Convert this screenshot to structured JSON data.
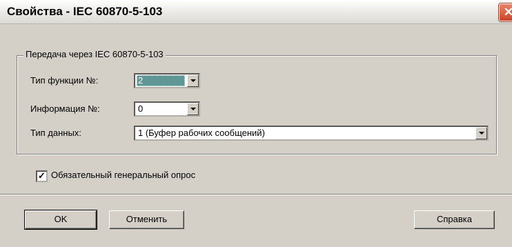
{
  "window": {
    "title": "Свойства - IEC 60870-5-103",
    "close_glyph": "✕"
  },
  "group": {
    "legend": "Передача через IEC 60870-5-103"
  },
  "fields": {
    "function_type": {
      "label": "Тип функции №:",
      "value": "2"
    },
    "info_number": {
      "label": "Информация №:",
      "value": "0"
    },
    "data_type": {
      "label": "Тип данных:",
      "value": "1 (Буфер рабочих сообщений)"
    }
  },
  "checkbox": {
    "label": "Обязательный генеральный опрос",
    "checked": true,
    "check_glyph": "✓"
  },
  "buttons": {
    "ok": "OK",
    "cancel": "Отменить",
    "help": "Справка"
  },
  "colors": {
    "face": "#d4d0c8",
    "selection": "#5e9796",
    "close": "#c8452a"
  }
}
